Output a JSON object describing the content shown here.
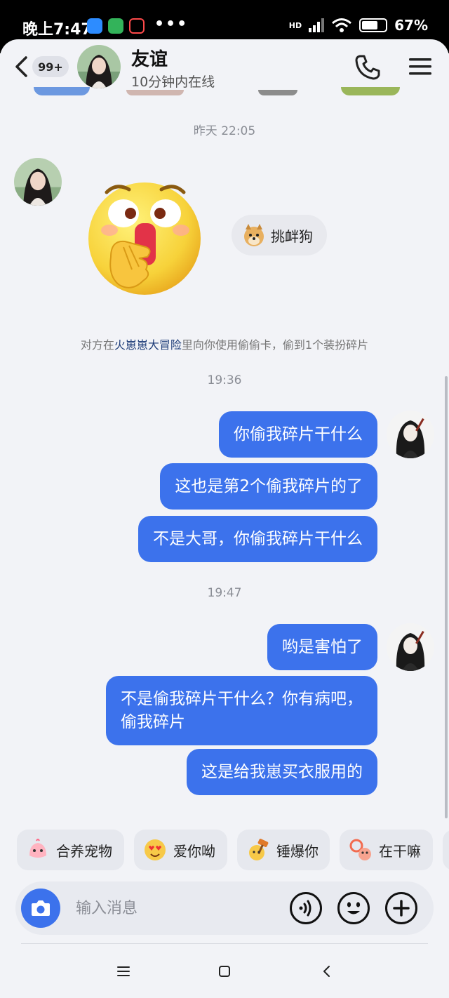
{
  "status_bar": {
    "time": "晚上7:47",
    "more": "•••",
    "network": "HD",
    "battery": "67%"
  },
  "header": {
    "unread_badge": "99+",
    "name": "友谊",
    "status": "10分钟内在线"
  },
  "messages": {
    "ts_1": "昨天 22:05",
    "sticker_tag": "挑衅狗",
    "system": {
      "prefix": "对方在",
      "game": "火崽崽大冒险",
      "suffix": "里向你使用偷偷卡，偷到1个装扮碎片"
    },
    "ts_2": "19:36",
    "group1": [
      "你偷我碎片干什么",
      "这也是第2个偷我碎片的了",
      "不是大哥，你偷我碎片干什么"
    ],
    "ts_3": "19:47",
    "group2": [
      "哟是害怕了",
      "不是偷我碎片干什么？你有病吧，\n偷我碎片",
      "这是给我崽买衣服用的"
    ]
  },
  "quick_replies": [
    "合养宠物",
    "爱你呦",
    "锤爆你",
    "在干嘛"
  ],
  "input": {
    "placeholder": "输入消息"
  },
  "colors": {
    "bubble": "#3c72ec",
    "background": "#f2f3f7",
    "chip": "#e6e8ee"
  },
  "icons": {
    "back": "chevron-left-icon",
    "call": "phone-icon",
    "menu": "menu-icon",
    "camera": "camera-icon",
    "voice": "voice-icon",
    "emoji": "smiley-icon",
    "plus": "plus-icon",
    "nav": [
      "nav-menu-icon",
      "nav-home-icon",
      "nav-back-icon"
    ]
  }
}
